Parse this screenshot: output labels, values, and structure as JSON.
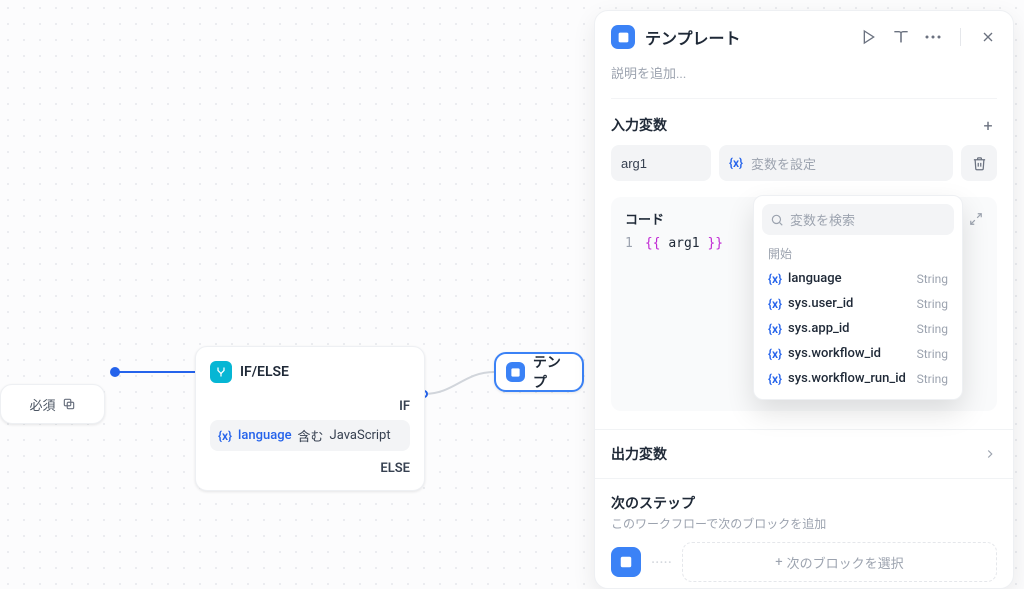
{
  "canvas": {
    "required_label": "必須",
    "ifelse": {
      "title": "IF/ELSE",
      "if_label": "IF",
      "else_label": "ELSE",
      "cond_var": "language",
      "cond_op": "含む",
      "cond_value": "JavaScript"
    },
    "template_node_label": "テンプ"
  },
  "panel": {
    "title": "テンプレート",
    "desc_placeholder": "説明を追加...",
    "input_vars_title": "入力変数",
    "arg_name": "arg1",
    "varset_placeholder": "変数を設定",
    "code_label": "コード",
    "code_lineno": "1",
    "code_open": "{{",
    "code_var": "arg1",
    "code_close": "}}",
    "dropdown": {
      "search_placeholder": "変数を検索",
      "group_label": "開始",
      "items": [
        {
          "name": "language",
          "type": "String"
        },
        {
          "name": "sys.user_id",
          "type": "String"
        },
        {
          "name": "sys.app_id",
          "type": "String"
        },
        {
          "name": "sys.workflow_id",
          "type": "String"
        },
        {
          "name": "sys.workflow_run_id",
          "type": "String"
        }
      ]
    },
    "output_vars_title": "出力変数",
    "next_step_title": "次のステップ",
    "next_step_desc": "このワークフローで次のブロックを追加",
    "next_block_placeholder": "次のブロックを選択"
  }
}
